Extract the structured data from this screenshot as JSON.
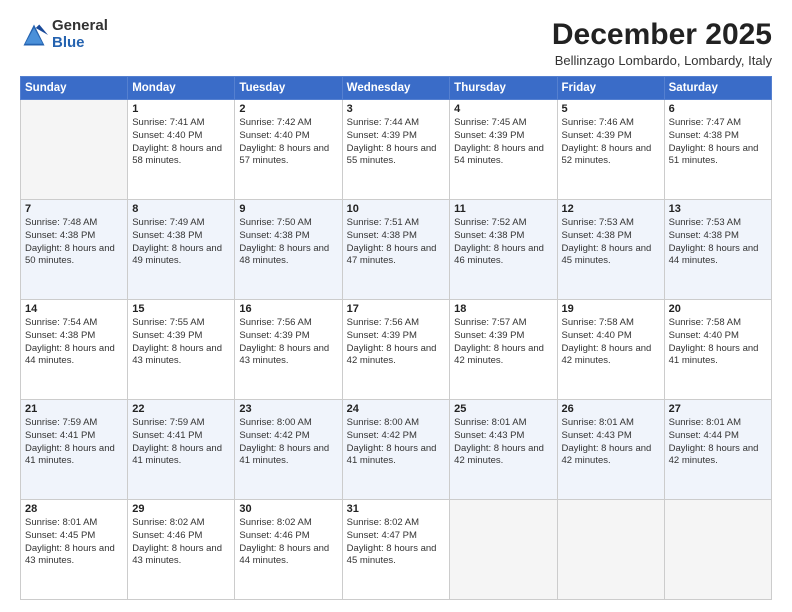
{
  "header": {
    "logo_general": "General",
    "logo_blue": "Blue",
    "title": "December 2025",
    "subtitle": "Bellinzago Lombardo, Lombardy, Italy"
  },
  "weekdays": [
    "Sunday",
    "Monday",
    "Tuesday",
    "Wednesday",
    "Thursday",
    "Friday",
    "Saturday"
  ],
  "weeks": [
    [
      {
        "day": "",
        "sunrise": "",
        "sunset": "",
        "daylight": ""
      },
      {
        "day": "1",
        "sunrise": "Sunrise: 7:41 AM",
        "sunset": "Sunset: 4:40 PM",
        "daylight": "Daylight: 8 hours and 58 minutes."
      },
      {
        "day": "2",
        "sunrise": "Sunrise: 7:42 AM",
        "sunset": "Sunset: 4:40 PM",
        "daylight": "Daylight: 8 hours and 57 minutes."
      },
      {
        "day": "3",
        "sunrise": "Sunrise: 7:44 AM",
        "sunset": "Sunset: 4:39 PM",
        "daylight": "Daylight: 8 hours and 55 minutes."
      },
      {
        "day": "4",
        "sunrise": "Sunrise: 7:45 AM",
        "sunset": "Sunset: 4:39 PM",
        "daylight": "Daylight: 8 hours and 54 minutes."
      },
      {
        "day": "5",
        "sunrise": "Sunrise: 7:46 AM",
        "sunset": "Sunset: 4:39 PM",
        "daylight": "Daylight: 8 hours and 52 minutes."
      },
      {
        "day": "6",
        "sunrise": "Sunrise: 7:47 AM",
        "sunset": "Sunset: 4:38 PM",
        "daylight": "Daylight: 8 hours and 51 minutes."
      }
    ],
    [
      {
        "day": "7",
        "sunrise": "Sunrise: 7:48 AM",
        "sunset": "Sunset: 4:38 PM",
        "daylight": "Daylight: 8 hours and 50 minutes."
      },
      {
        "day": "8",
        "sunrise": "Sunrise: 7:49 AM",
        "sunset": "Sunset: 4:38 PM",
        "daylight": "Daylight: 8 hours and 49 minutes."
      },
      {
        "day": "9",
        "sunrise": "Sunrise: 7:50 AM",
        "sunset": "Sunset: 4:38 PM",
        "daylight": "Daylight: 8 hours and 48 minutes."
      },
      {
        "day": "10",
        "sunrise": "Sunrise: 7:51 AM",
        "sunset": "Sunset: 4:38 PM",
        "daylight": "Daylight: 8 hours and 47 minutes."
      },
      {
        "day": "11",
        "sunrise": "Sunrise: 7:52 AM",
        "sunset": "Sunset: 4:38 PM",
        "daylight": "Daylight: 8 hours and 46 minutes."
      },
      {
        "day": "12",
        "sunrise": "Sunrise: 7:53 AM",
        "sunset": "Sunset: 4:38 PM",
        "daylight": "Daylight: 8 hours and 45 minutes."
      },
      {
        "day": "13",
        "sunrise": "Sunrise: 7:53 AM",
        "sunset": "Sunset: 4:38 PM",
        "daylight": "Daylight: 8 hours and 44 minutes."
      }
    ],
    [
      {
        "day": "14",
        "sunrise": "Sunrise: 7:54 AM",
        "sunset": "Sunset: 4:38 PM",
        "daylight": "Daylight: 8 hours and 44 minutes."
      },
      {
        "day": "15",
        "sunrise": "Sunrise: 7:55 AM",
        "sunset": "Sunset: 4:39 PM",
        "daylight": "Daylight: 8 hours and 43 minutes."
      },
      {
        "day": "16",
        "sunrise": "Sunrise: 7:56 AM",
        "sunset": "Sunset: 4:39 PM",
        "daylight": "Daylight: 8 hours and 43 minutes."
      },
      {
        "day": "17",
        "sunrise": "Sunrise: 7:56 AM",
        "sunset": "Sunset: 4:39 PM",
        "daylight": "Daylight: 8 hours and 42 minutes."
      },
      {
        "day": "18",
        "sunrise": "Sunrise: 7:57 AM",
        "sunset": "Sunset: 4:39 PM",
        "daylight": "Daylight: 8 hours and 42 minutes."
      },
      {
        "day": "19",
        "sunrise": "Sunrise: 7:58 AM",
        "sunset": "Sunset: 4:40 PM",
        "daylight": "Daylight: 8 hours and 42 minutes."
      },
      {
        "day": "20",
        "sunrise": "Sunrise: 7:58 AM",
        "sunset": "Sunset: 4:40 PM",
        "daylight": "Daylight: 8 hours and 41 minutes."
      }
    ],
    [
      {
        "day": "21",
        "sunrise": "Sunrise: 7:59 AM",
        "sunset": "Sunset: 4:41 PM",
        "daylight": "Daylight: 8 hours and 41 minutes."
      },
      {
        "day": "22",
        "sunrise": "Sunrise: 7:59 AM",
        "sunset": "Sunset: 4:41 PM",
        "daylight": "Daylight: 8 hours and 41 minutes."
      },
      {
        "day": "23",
        "sunrise": "Sunrise: 8:00 AM",
        "sunset": "Sunset: 4:42 PM",
        "daylight": "Daylight: 8 hours and 41 minutes."
      },
      {
        "day": "24",
        "sunrise": "Sunrise: 8:00 AM",
        "sunset": "Sunset: 4:42 PM",
        "daylight": "Daylight: 8 hours and 41 minutes."
      },
      {
        "day": "25",
        "sunrise": "Sunrise: 8:01 AM",
        "sunset": "Sunset: 4:43 PM",
        "daylight": "Daylight: 8 hours and 42 minutes."
      },
      {
        "day": "26",
        "sunrise": "Sunrise: 8:01 AM",
        "sunset": "Sunset: 4:43 PM",
        "daylight": "Daylight: 8 hours and 42 minutes."
      },
      {
        "day": "27",
        "sunrise": "Sunrise: 8:01 AM",
        "sunset": "Sunset: 4:44 PM",
        "daylight": "Daylight: 8 hours and 42 minutes."
      }
    ],
    [
      {
        "day": "28",
        "sunrise": "Sunrise: 8:01 AM",
        "sunset": "Sunset: 4:45 PM",
        "daylight": "Daylight: 8 hours and 43 minutes."
      },
      {
        "day": "29",
        "sunrise": "Sunrise: 8:02 AM",
        "sunset": "Sunset: 4:46 PM",
        "daylight": "Daylight: 8 hours and 43 minutes."
      },
      {
        "day": "30",
        "sunrise": "Sunrise: 8:02 AM",
        "sunset": "Sunset: 4:46 PM",
        "daylight": "Daylight: 8 hours and 44 minutes."
      },
      {
        "day": "31",
        "sunrise": "Sunrise: 8:02 AM",
        "sunset": "Sunset: 4:47 PM",
        "daylight": "Daylight: 8 hours and 45 minutes."
      },
      {
        "day": "",
        "sunrise": "",
        "sunset": "",
        "daylight": ""
      },
      {
        "day": "",
        "sunrise": "",
        "sunset": "",
        "daylight": ""
      },
      {
        "day": "",
        "sunrise": "",
        "sunset": "",
        "daylight": ""
      }
    ]
  ]
}
